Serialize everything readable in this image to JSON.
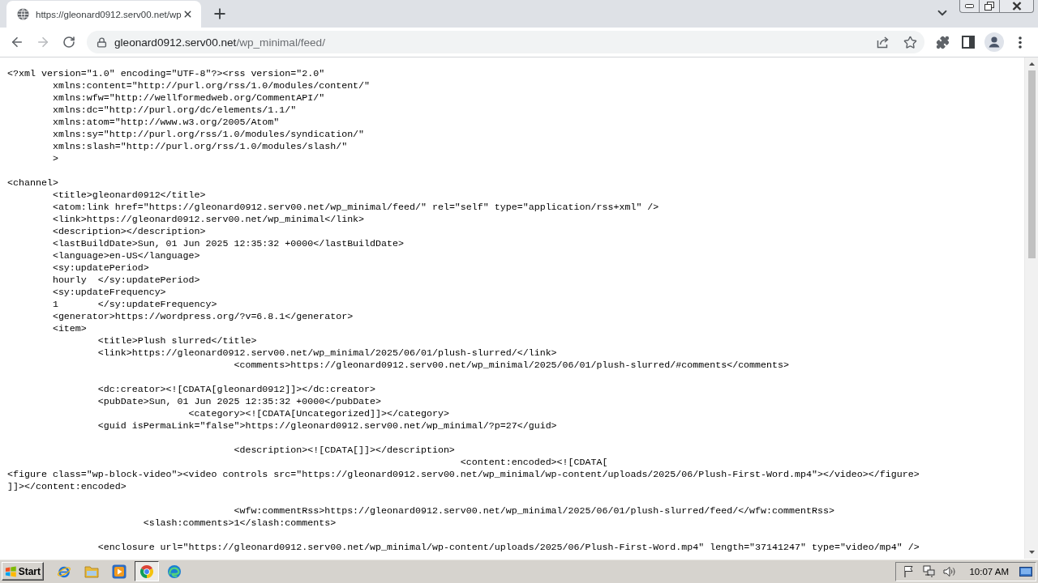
{
  "browser": {
    "tab": {
      "title": "https://gleonard0912.serv00.net/wp",
      "selected": true
    },
    "navigation": [
      {
        "kind": "back",
        "disabled": false
      },
      {
        "kind": "forward",
        "disabled": true
      },
      {
        "kind": "reload",
        "disabled": false
      }
    ],
    "address_bar": {
      "host": "gleonard0912.serv00.net",
      "path": "/wp_minimal/feed/"
    }
  },
  "document": {
    "blocks": [
      {
        "lines": [
          "<?xml version=\"1.0\" encoding=\"UTF-8\"?><rss version=\"2.0\"",
          "\txmlns:content=\"http://purl.org/rss/1.0/modules/content/\"",
          "\txmlns:wfw=\"http://wellformedweb.org/CommentAPI/\"",
          "\txmlns:dc=\"http://purl.org/dc/elements/1.1/\"",
          "\txmlns:atom=\"http://www.w3.org/2005/Atom\"",
          "\txmlns:sy=\"http://purl.org/rss/1.0/modules/syndication/\"",
          "\txmlns:slash=\"http://purl.org/rss/1.0/modules/slash/\"",
          "\t>"
        ]
      },
      {
        "lines": [
          "<channel>",
          "\t<title>gleonard0912</title>",
          "\t<atom:link href=\"https://gleonard0912.serv00.net/wp_minimal/feed/\" rel=\"self\" type=\"application/rss+xml\" />",
          "\t<link>https://gleonard0912.serv00.net/wp_minimal</link>",
          "\t<description></description>",
          "\t<lastBuildDate>Sun, 01 Jun 2025 12:35:32 +0000</lastBuildDate>",
          "\t<language>en-US</language>",
          "\t<sy:updatePeriod>",
          "\thourly\t</sy:updatePeriod>",
          "\t<sy:updateFrequency>",
          "\t1\t</sy:updateFrequency>",
          "\t<generator>https://wordpress.org/?v=6.8.1</generator>",
          "\t<item>",
          "\t\t<title>Plush slurred</title>",
          "\t\t<link>https://gleonard0912.serv00.net/wp_minimal/2025/06/01/plush-slurred/</link>",
          "\t\t\t\t\t<comments>https://gleonard0912.serv00.net/wp_minimal/2025/06/01/plush-slurred/#comments</comments>"
        ]
      },
      {
        "lines": [
          "\t\t<dc:creator><![CDATA[gleonard0912]]></dc:creator>",
          "\t\t<pubDate>Sun, 01 Jun 2025 12:35:32 +0000</pubDate>",
          "\t\t\t\t<category><![CDATA[Uncategorized]]></category>",
          "\t\t<guid isPermaLink=\"false\">https://gleonard0912.serv00.net/wp_minimal/?p=27</guid>"
        ]
      },
      {
        "lines": [
          "\t\t\t\t\t<description><![CDATA[]]></description>",
          "\t\t\t\t\t\t\t\t\t\t<content:encoded><![CDATA[",
          "<figure class=\"wp-block-video\"><video controls src=\"https://gleonard0912.serv00.net/wp_minimal/wp-content/uploads/2025/06/Plush-First-Word.mp4\"></video></figure>",
          "]]></content:encoded>"
        ]
      },
      {
        "lines": [
          "\t\t\t\t\t<wfw:commentRss>https://gleonard0912.serv00.net/wp_minimal/2025/06/01/plush-slurred/feed/</wfw:commentRss>",
          "\t\t\t<slash:comments>1</slash:comments>"
        ]
      },
      {
        "lines": [
          "\t\t<enclosure url=\"https://gleonard0912.serv00.net/wp_minimal/wp-content/uploads/2025/06/Plush-First-Word.mp4\" length=\"37141247\" type=\"video/mp4\" />"
        ]
      }
    ]
  },
  "taskbar": {
    "start": "Start",
    "apps": [
      {
        "kind": "e_ring",
        "selected": false
      },
      {
        "kind": "folder",
        "selected": false
      },
      {
        "kind": "player",
        "selected": false
      },
      {
        "kind": "ring",
        "selected": true
      },
      {
        "kind": "wave",
        "selected": false
      }
    ],
    "clock": "10:07 AM"
  }
}
